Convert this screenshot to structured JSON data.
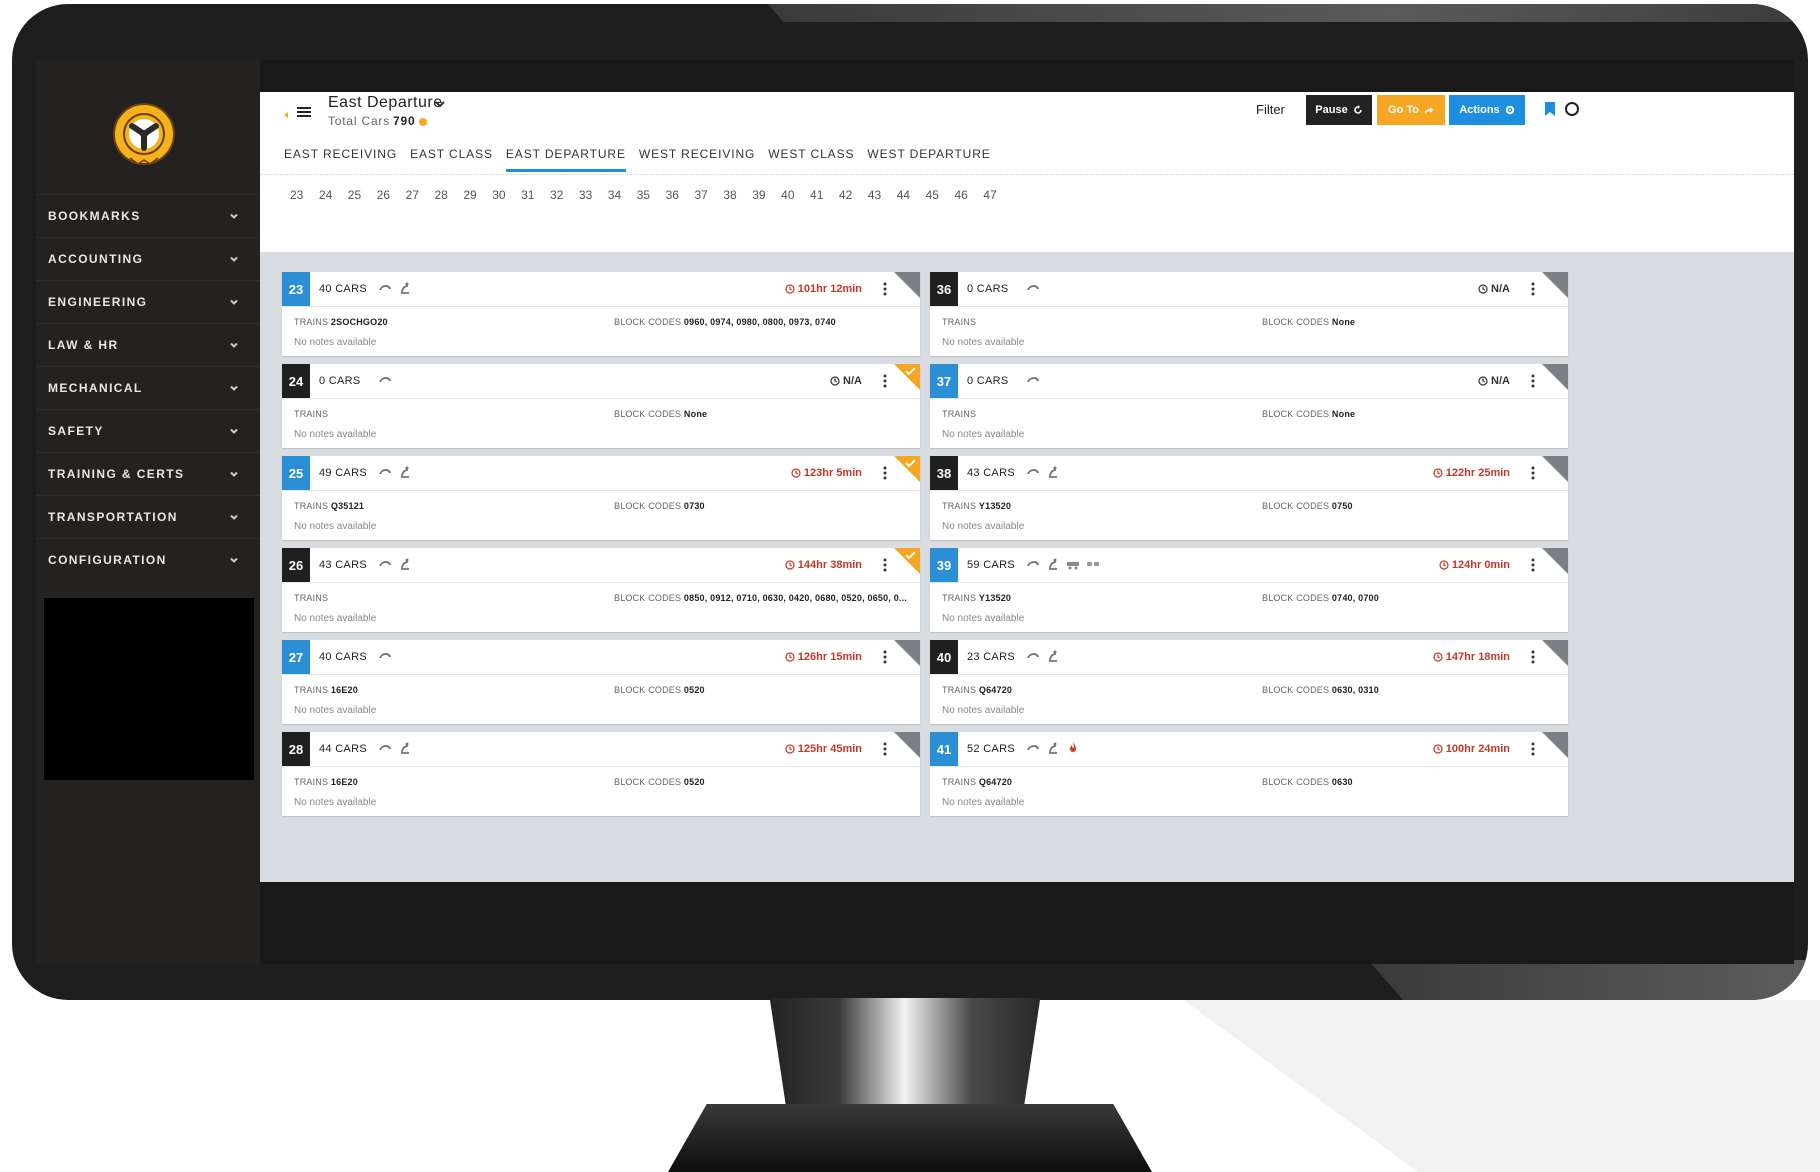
{
  "header": {
    "title": "East Departure",
    "total_label": "Total Cars",
    "total_value": "790",
    "filter_label": "Filter",
    "pause_label": "Pause",
    "goto_label": "Go To",
    "actions_label": "Actions"
  },
  "sidebar": {
    "items": [
      {
        "label": "BOOKMARKS"
      },
      {
        "label": "ACCOUNTING"
      },
      {
        "label": "ENGINEERING"
      },
      {
        "label": "LAW & HR"
      },
      {
        "label": "MECHANICAL"
      },
      {
        "label": "SAFETY"
      },
      {
        "label": "TRAINING & CERTS"
      },
      {
        "label": "TRANSPORTATION"
      },
      {
        "label": "CONFIGURATION"
      }
    ]
  },
  "tabs": [
    {
      "label": "EAST RECEIVING"
    },
    {
      "label": "EAST CLASS"
    },
    {
      "label": "EAST DEPARTURE"
    },
    {
      "label": "WEST RECEIVING"
    },
    {
      "label": "WEST CLASS"
    },
    {
      "label": "WEST DEPARTURE"
    }
  ],
  "tracks": [
    "23",
    "24",
    "25",
    "26",
    "27",
    "28",
    "29",
    "30",
    "31",
    "32",
    "33",
    "34",
    "35",
    "36",
    "37",
    "38",
    "39",
    "40",
    "41",
    "42",
    "43",
    "44",
    "45",
    "46",
    "47"
  ],
  "labels": {
    "trains": "TRAINS",
    "block_codes": "BLOCK CODES"
  },
  "cards": [
    {
      "num": "23",
      "color": "blue",
      "cars": "40 CARS",
      "icons": [
        "car-icon",
        "car-hook-icon"
      ],
      "time": "101hr 12min",
      "time_color": "red",
      "corner": "gray",
      "trains": "2SOCHGO20",
      "blocks": "0960, 0974, 0980, 0800, 0973, 0740",
      "notes": "No notes available"
    },
    {
      "num": "36",
      "color": "dark",
      "cars": "0 CARS",
      "icons": [
        "car-icon"
      ],
      "time": "N/A",
      "time_color": "gray",
      "corner": "gray",
      "trains": "",
      "blocks": "None",
      "notes": "No notes available"
    },
    {
      "num": "24",
      "color": "dark",
      "cars": "0 CARS",
      "icons": [
        "car-icon"
      ],
      "time": "N/A",
      "time_color": "gray",
      "corner": "orange",
      "trains": "",
      "blocks": "None",
      "notes": "No notes available"
    },
    {
      "num": "37",
      "color": "blue",
      "cars": "0 CARS",
      "icons": [
        "car-icon"
      ],
      "time": "N/A",
      "time_color": "gray",
      "corner": "gray",
      "trains": "",
      "blocks": "None",
      "notes": "No notes available"
    },
    {
      "num": "25",
      "color": "blue",
      "cars": "49 CARS",
      "icons": [
        "car-icon",
        "car-hook-icon"
      ],
      "time": "123hr 5min",
      "time_color": "red",
      "corner": "orange",
      "trains": "Q35121",
      "blocks": "0730",
      "notes": "No notes available"
    },
    {
      "num": "38",
      "color": "dark",
      "cars": "43 CARS",
      "icons": [
        "car-icon",
        "car-hook-icon"
      ],
      "time": "122hr 25min",
      "time_color": "red",
      "corner": "gray",
      "trains": "Y13520",
      "blocks": "0750",
      "notes": "No notes available"
    },
    {
      "num": "26",
      "color": "dark",
      "cars": "43 CARS",
      "icons": [
        "car-icon",
        "car-hook-icon"
      ],
      "time": "144hr 38min",
      "time_color": "red",
      "corner": "orange",
      "trains": "",
      "blocks": "0850, 0912, 0710, 0630, 0420, 0680, 0520, 0650, 0...",
      "notes": "No notes available"
    },
    {
      "num": "39",
      "color": "blue",
      "cars": "59 CARS",
      "icons": [
        "car-icon",
        "car-hook-icon",
        "flatcar-icon",
        "tank-car-icon"
      ],
      "time": "124hr 0min",
      "time_color": "red",
      "corner": "gray",
      "trains": "Y13520",
      "blocks": "0740, 0700",
      "notes": "No notes available"
    },
    {
      "num": "27",
      "color": "blue",
      "cars": "40 CARS",
      "icons": [
        "car-icon"
      ],
      "time": "126hr 15min",
      "time_color": "red",
      "corner": "gray",
      "trains": "16E20",
      "blocks": "0520",
      "notes": "No notes available"
    },
    {
      "num": "40",
      "color": "dark",
      "cars": "23 CARS",
      "icons": [
        "car-icon",
        "car-hook-icon"
      ],
      "time": "147hr 18min",
      "time_color": "red",
      "corner": "gray",
      "trains": "Q64720",
      "blocks": "0630, 0310",
      "notes": "No notes available"
    },
    {
      "num": "28",
      "color": "dark",
      "cars": "44 CARS",
      "icons": [
        "car-icon",
        "car-hook-icon"
      ],
      "time": "125hr 45min",
      "time_color": "red",
      "corner": "gray",
      "trains": "16E20",
      "blocks": "0520",
      "notes": "No notes available"
    },
    {
      "num": "41",
      "color": "blue",
      "cars": "52 CARS",
      "icons": [
        "car-icon",
        "car-hook-icon",
        "fire-icon"
      ],
      "time": "100hr 24min",
      "time_color": "red",
      "corner": "gray",
      "trains": "Q64720",
      "blocks": "0630",
      "notes": "No notes available"
    }
  ],
  "colors": {
    "accent_blue": "#1e8fe0",
    "accent_orange": "#f5a623",
    "alert_red": "#c0392b",
    "sidebar_bg": "#242121"
  }
}
